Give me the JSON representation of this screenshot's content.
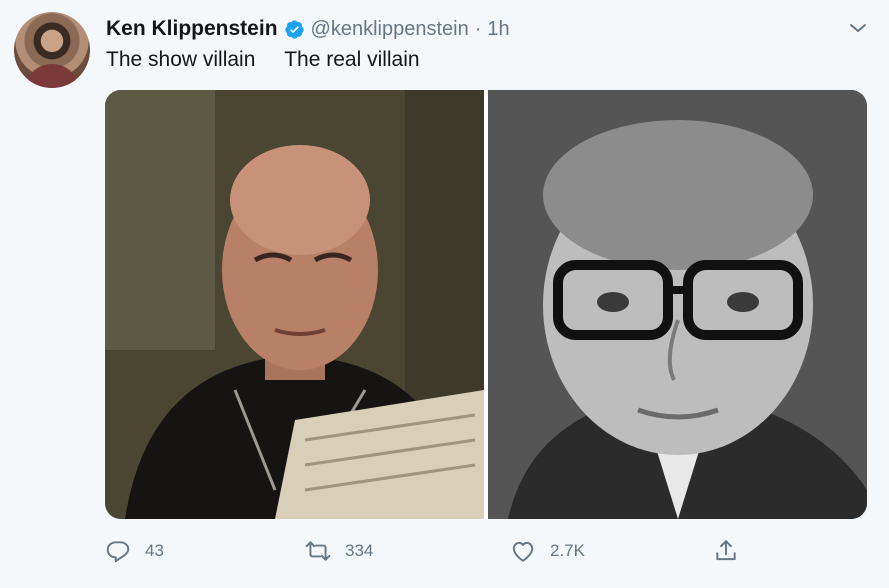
{
  "tweet": {
    "author_name": "Ken Klippenstein",
    "handle": "@kenklippenstein",
    "separator": "·",
    "time": "1h",
    "text": "The show villain     The real villain"
  },
  "media": {
    "left_image": "brando-villain-photo",
    "right_image": "kissinger-portrait-photo"
  },
  "stats": {
    "replies": "43",
    "retweets": "334",
    "likes": "2.7K"
  },
  "icons": {
    "verified": "verified-icon",
    "caret": "chevron-down-icon",
    "reply": "reply-icon",
    "retweet": "retweet-icon",
    "like": "heart-icon",
    "share": "share-icon"
  },
  "colors": {
    "verified_blue": "#1da1f2",
    "muted_text": "#657786",
    "background": "#f5f8fa"
  }
}
